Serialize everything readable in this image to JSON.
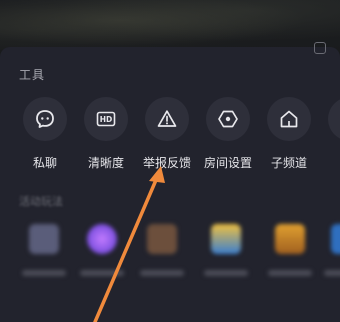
{
  "tools_section": {
    "title": "工具",
    "items": [
      {
        "label": "私聊",
        "icon": "chat-bubble-icon"
      },
      {
        "label": "清晰度",
        "icon": "hd-icon"
      },
      {
        "label": "举报反馈",
        "icon": "warning-icon"
      },
      {
        "label": "房间设置",
        "icon": "hexagon-settings-icon"
      },
      {
        "label": "子频道",
        "icon": "home-icon"
      }
    ]
  },
  "activity_section": {
    "title": "活动玩法"
  },
  "colors": {
    "sheet_bg": "#22232d",
    "icon_circle_bg": "#2e2f3a",
    "annotation_arrow": "#f08a3c"
  }
}
